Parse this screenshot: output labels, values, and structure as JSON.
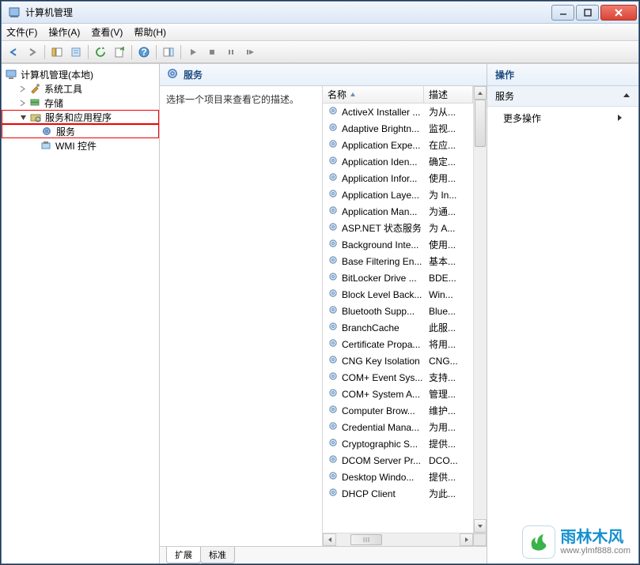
{
  "window": {
    "title": "计算机管理"
  },
  "menu": {
    "file": "文件(F)",
    "operate": "操作(A)",
    "view": "查看(V)",
    "help": "帮助(H)"
  },
  "sidebar": {
    "root": "计算机管理(本地)",
    "tools": "系统工具",
    "storage": "存储",
    "apps": "服务和应用程序",
    "services": "服务",
    "wmi": "WMI 控件"
  },
  "main": {
    "header": "服务",
    "prompt": "选择一个项目来查看它的描述。",
    "col_name": "名称",
    "col_desc": "描述"
  },
  "rows": [
    {
      "name": "ActiveX Installer ...",
      "desc": "为从..."
    },
    {
      "name": "Adaptive Brightn...",
      "desc": "监视..."
    },
    {
      "name": "Application Expe...",
      "desc": "在应..."
    },
    {
      "name": "Application Iden...",
      "desc": "确定..."
    },
    {
      "name": "Application Infor...",
      "desc": "使用..."
    },
    {
      "name": "Application Laye...",
      "desc": "为 In..."
    },
    {
      "name": "Application Man...",
      "desc": "为通..."
    },
    {
      "name": "ASP.NET 状态服务",
      "desc": "为 A..."
    },
    {
      "name": "Background Inte...",
      "desc": "使用..."
    },
    {
      "name": "Base Filtering En...",
      "desc": "基本..."
    },
    {
      "name": "BitLocker Drive ...",
      "desc": "BDE..."
    },
    {
      "name": "Block Level Back...",
      "desc": "Win..."
    },
    {
      "name": "Bluetooth Supp...",
      "desc": "Blue..."
    },
    {
      "name": "BranchCache",
      "desc": "此服..."
    },
    {
      "name": "Certificate Propa...",
      "desc": "将用..."
    },
    {
      "name": "CNG Key Isolation",
      "desc": "CNG..."
    },
    {
      "name": "COM+ Event Sys...",
      "desc": "支持..."
    },
    {
      "name": "COM+ System A...",
      "desc": "管理..."
    },
    {
      "name": "Computer Brow...",
      "desc": "维护..."
    },
    {
      "name": "Credential Mana...",
      "desc": "为用..."
    },
    {
      "name": "Cryptographic S...",
      "desc": "提供..."
    },
    {
      "name": "DCOM Server Pr...",
      "desc": "DCO..."
    },
    {
      "name": "Desktop Windo...",
      "desc": "提供..."
    },
    {
      "name": "DHCP Client",
      "desc": "为此..."
    }
  ],
  "tabs": {
    "extended": "扩展",
    "standard": "标准"
  },
  "actions": {
    "header": "操作",
    "group": "服务",
    "more": "更多操作"
  },
  "watermark": {
    "brand": "雨林木风",
    "url": "www.ylmf888.com"
  }
}
